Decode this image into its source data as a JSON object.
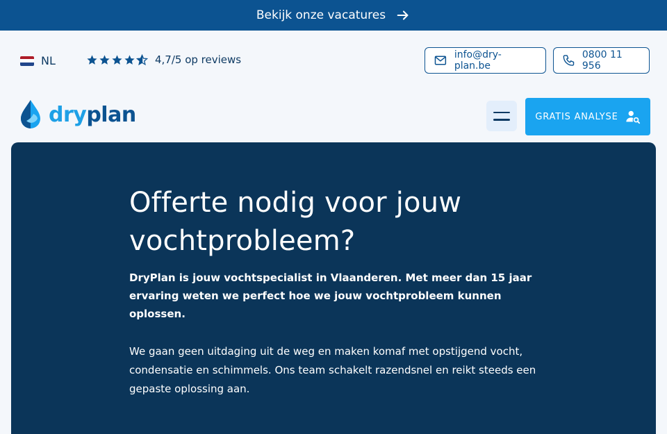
{
  "topbar": {
    "label": "Bekijk onze vacatures",
    "icon": "arrow-right-icon"
  },
  "language": {
    "code": "NL",
    "flag_colors": [
      "#ae1c28",
      "#ffffff",
      "#21468b"
    ]
  },
  "rating": {
    "stars": 4.7,
    "text": "4,7/5 op reviews"
  },
  "contact": {
    "email": "info@dry-plan.be",
    "phone": "0800 11 956"
  },
  "logo": {
    "part1": "dry",
    "part2": "plan"
  },
  "cta": {
    "label": "GRATIS ANALYSE"
  },
  "hero": {
    "title": "Offerte nodig voor jouw vochtprobleem?",
    "lead": "DryPlan is jouw vochtspecialist in Vlaanderen. Met meer dan 15 jaar ervaring weten we perfect hoe we jouw vochtprobleem kunnen oplossen.",
    "body": "We gaan geen uitdaging uit de weg en maken komaf met opstijgend vocht, condensatie en schimmels. Ons team schakelt razendsnel en reikt steeds een gepaste oplossing aan."
  },
  "colors": {
    "brand_dark": "#0c5391",
    "brand_light": "#1aa4f0",
    "hero_bg": "#0b3559"
  }
}
